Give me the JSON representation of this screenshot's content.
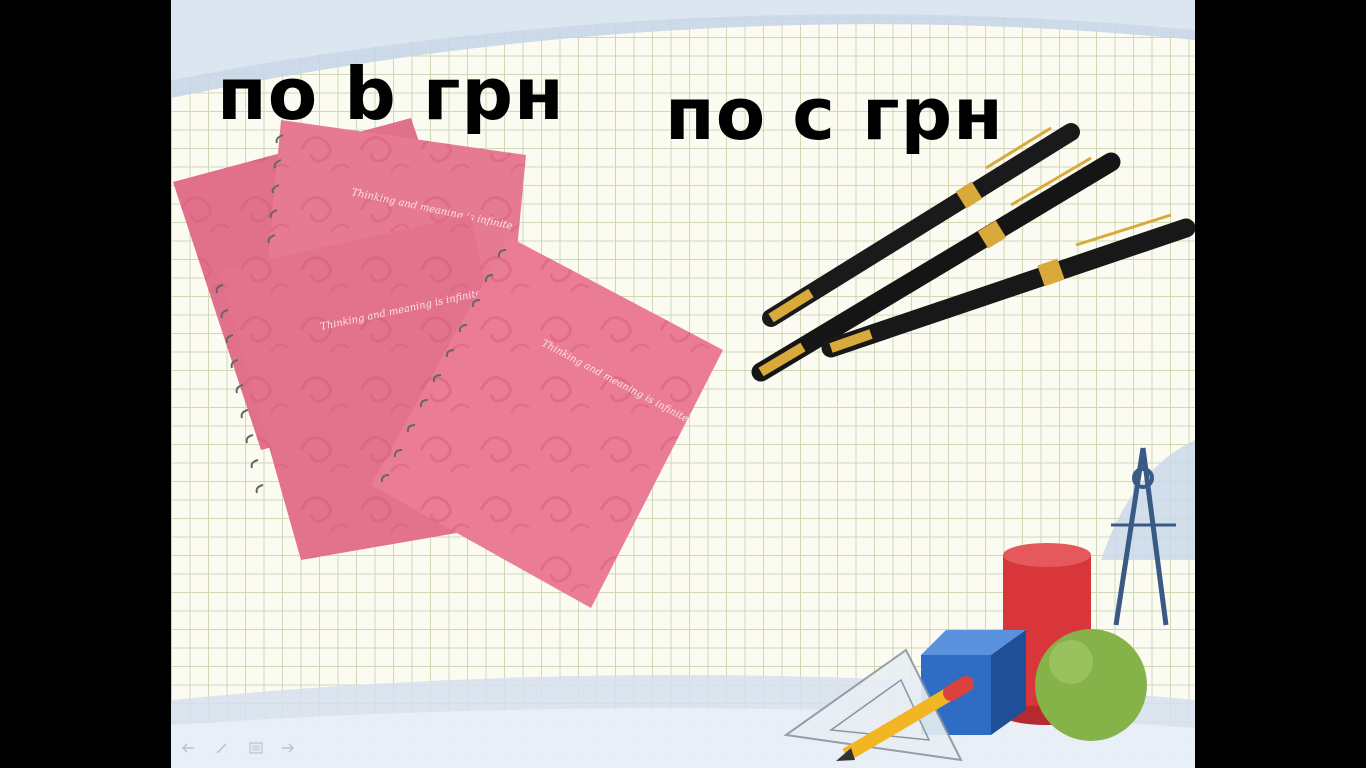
{
  "slide": {
    "caption_notebooks": "по b грн",
    "caption_pens": "по c грн"
  },
  "notebook": {
    "cover_script": "Thinking and meaning is infinite"
  },
  "colors": {
    "notebook_pink": "#e4748e",
    "frame_blue": "#c7d6e8",
    "grid_line": "#cfd9b6",
    "cylinder_red": "#d8363a",
    "cube_blue": "#2f6cc4",
    "sphere_green": "#86b24a"
  },
  "nav_icons": [
    "prev-icon",
    "pen-icon",
    "menu-icon",
    "next-icon"
  ]
}
